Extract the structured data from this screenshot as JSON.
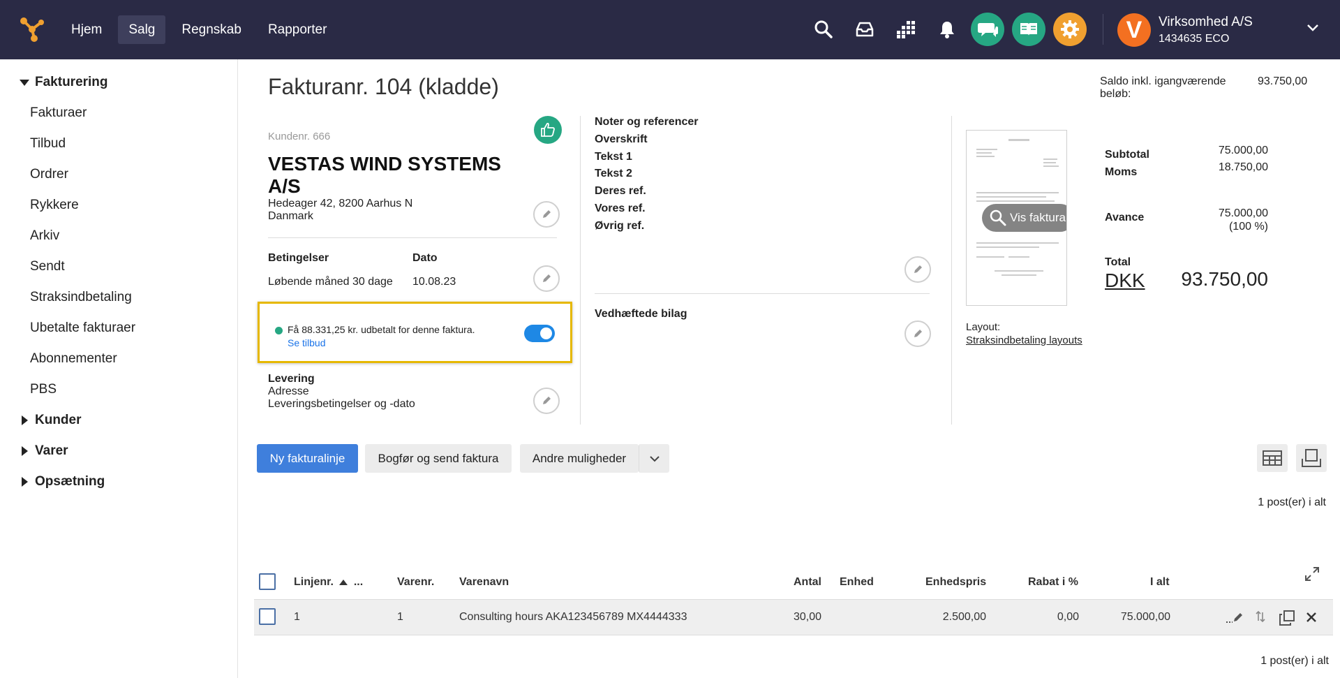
{
  "topbar": {
    "nav": [
      "Hjem",
      "Salg",
      "Regnskab",
      "Rapporter"
    ],
    "active_nav": "Salg",
    "company": {
      "name": "Virksomhed A/S",
      "id": "1434635 ECO",
      "logo_letter": "V",
      "logo_color": "#f37021"
    },
    "icons": [
      "search-icon",
      "inbox-icon",
      "apps-icon",
      "bell-icon",
      "chat-icon",
      "book-icon",
      "gear-icon"
    ],
    "colors": {
      "bar": "#2a2a45",
      "chat": "#26a783",
      "book": "#26a783",
      "gear": "#f0a030"
    }
  },
  "sidebar": {
    "fakturering": "Fakturering",
    "items": [
      "Fakturaer",
      "Tilbud",
      "Ordrer",
      "Rykkere",
      "Arkiv",
      "Sendt",
      "Straksindbetaling",
      "Ubetalte fakturaer",
      "Abonnementer",
      "PBS"
    ],
    "kunder": "Kunder",
    "varer": "Varer",
    "opsaetning": "Opsætning"
  },
  "invoice": {
    "title": "Fakturanr. 104 (kladde)",
    "saldo_label": "Saldo inkl. igangværende beløb:",
    "saldo_value": "93.750,00",
    "kundenr": "Kundenr. 666",
    "customer_name": "VESTAS WIND SYSTEMS A/S",
    "address_line1": "Hedeager 42, 8200 Aarhus N",
    "address_line2": "Danmark",
    "betingelser_label": "Betingelser",
    "betingelser_value": "Løbende måned 30 dage",
    "dato_label": "Dato",
    "dato_value": "10.08.23",
    "offer_text": "Få 88.331,25 kr. udbetalt for denne faktura.",
    "offer_link": "Se tilbud",
    "levering_label": "Levering",
    "levering_adresse": "Adresse",
    "levering_betingelser": "Leveringsbetingelser og -dato",
    "notes_title": "Noter og referencer",
    "notes": [
      "Overskrift",
      "Tekst 1",
      "Tekst 2",
      "Deres ref.",
      "Vores ref.",
      "Øvrig ref."
    ],
    "attachments": "Vedhæftede bilag",
    "vis_faktura": "Vis faktura",
    "layout_label": "Layout:",
    "layout_link": "Straksindbetaling layouts"
  },
  "totals": {
    "subtotal_label": "Subtotal",
    "subtotal_value": "75.000,00",
    "moms_label": "Moms",
    "moms_value": "18.750,00",
    "avance_label": "Avance",
    "avance_value": "75.000,00",
    "avance_pct": "(100 %)",
    "total_label": "Total",
    "currency": "DKK",
    "total_value": "93.750,00"
  },
  "actions": {
    "new_line": "Ny fakturalinje",
    "book_send": "Bogfør og send faktura",
    "other": "Andre muligheder"
  },
  "table": {
    "count_top": "1 post(er) i alt",
    "count_bottom": "1 post(er) i alt",
    "headers": {
      "linjenr": "Linjenr.",
      "more": "...",
      "varenr": "Varenr.",
      "varenavn": "Varenavn",
      "antal": "Antal",
      "enhed": "Enhed",
      "enhedspris": "Enhedspris",
      "rabat": "Rabat i %",
      "ialt": "I alt"
    },
    "rows": [
      {
        "linjenr": "1",
        "varenr": "1",
        "varenavn": "Consulting hours AKA123456789 MX4444333",
        "antal": "30,00",
        "enhed": "",
        "enhedspris": "2.500,00",
        "rabat": "0,00",
        "ialt": "75.000,00"
      }
    ]
  }
}
